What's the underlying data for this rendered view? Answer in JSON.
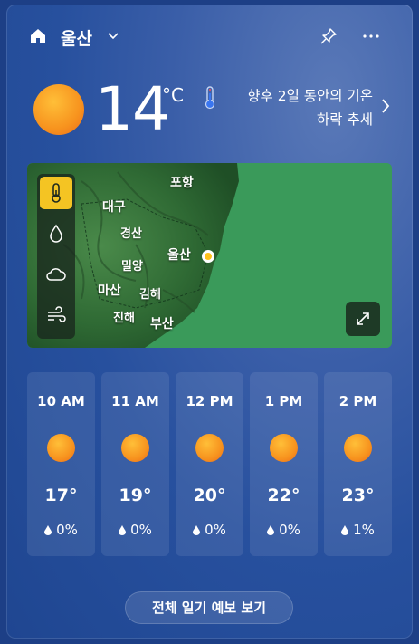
{
  "header": {
    "location": "울산",
    "home_icon": "home-icon",
    "pin_icon": "pin-icon",
    "more_icon": "more-icon"
  },
  "current": {
    "temperature": "14",
    "unit": "°C",
    "condition_icon": "sun-icon",
    "note_line1": "향후 2일 동안의 기온",
    "note_line2": "하락 추세"
  },
  "map": {
    "labels": {
      "pohang": "포항",
      "daegu": "대구",
      "gyeongsan": "경산",
      "ulsan": "울산",
      "miryang": "밀양",
      "masan": "마산",
      "gimhae": "김해",
      "jinhae": "진해",
      "busan": "부산"
    },
    "layers": [
      "thermometer-icon",
      "drop-icon",
      "cloud-icon",
      "wind-icon"
    ],
    "active_layer": "thermometer"
  },
  "hourly": [
    {
      "time": "10 AM",
      "temp": "17°",
      "precip": "0%"
    },
    {
      "time": "11 AM",
      "temp": "19°",
      "precip": "0%"
    },
    {
      "time": "12 PM",
      "temp": "20°",
      "precip": "0%"
    },
    {
      "time": "1 PM",
      "temp": "22°",
      "precip": "0%"
    },
    {
      "time": "2 PM",
      "temp": "23°",
      "precip": "1%"
    }
  ],
  "footer": {
    "full_forecast_label": "전체 일기 예보 보기"
  },
  "colors": {
    "background": "#27509e",
    "sun": "#f7931e",
    "active_layer": "#f4c423",
    "map_land": "#3b9a5b"
  }
}
